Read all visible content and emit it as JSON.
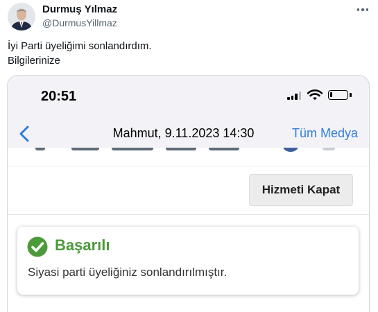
{
  "tweet": {
    "display_name": "Durmuş Yılmaz",
    "handle": "@DurmusYillmaz",
    "text_line1": "İyi Parti üyeliğimi sonlandırdım.",
    "text_line2": "Bilgilerinize"
  },
  "screenshot": {
    "status_bar": {
      "time": "20:51",
      "battery_level": 0.15
    },
    "nav": {
      "title": "Mahmut, 9.11.2023 14:30",
      "right_link": "Tüm Medya",
      "back_icon": "chevron-left-icon"
    },
    "page": {
      "close_service_button": "Hizmeti Kapat",
      "alert": {
        "title": "Başarılı",
        "message": "Siyasi parti üyeliğiniz sonlandırılmıştır.",
        "icon": "check-circle-icon"
      }
    }
  },
  "colors": {
    "link_blue": "#2f7ddc",
    "success_green": "#4c9a3b",
    "secondary_text": "#536471"
  }
}
